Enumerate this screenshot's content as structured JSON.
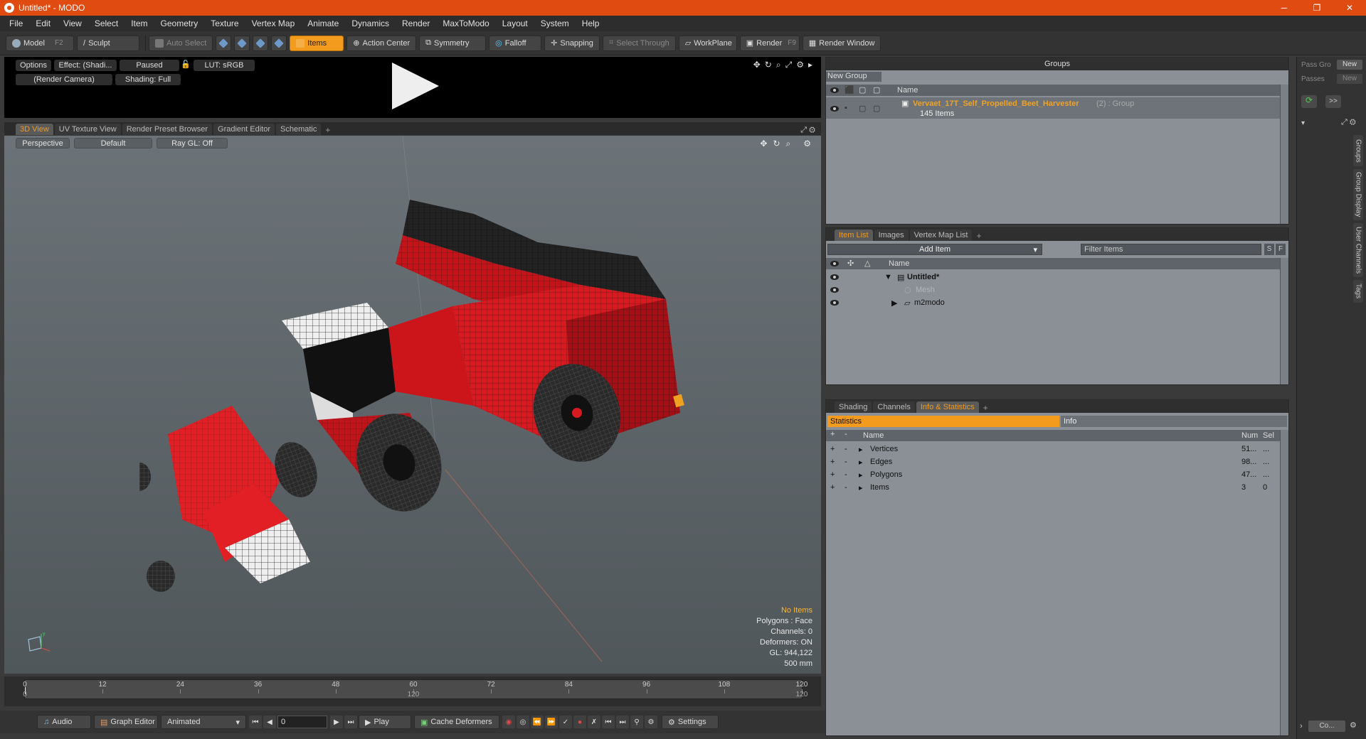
{
  "window": {
    "title": "Untitled* - MODO",
    "minimize": "─",
    "maximize": "❐",
    "close": "✕"
  },
  "menu": [
    "File",
    "Edit",
    "View",
    "Select",
    "Item",
    "Geometry",
    "Texture",
    "Vertex Map",
    "Animate",
    "Dynamics",
    "Render",
    "MaxToModo",
    "Layout",
    "System",
    "Help"
  ],
  "toolbar": {
    "model": "Model",
    "model_key": "F2",
    "sculpt": "Sculpt",
    "auto_select": "Auto Select",
    "items": "Items",
    "action_center": "Action Center",
    "symmetry": "Symmetry",
    "falloff": "Falloff",
    "snapping": "Snapping",
    "select_through": "Select Through",
    "workplane": "WorkPlane",
    "render": "Render",
    "render_key": "F9",
    "render_window": "Render Window"
  },
  "preview": {
    "options": "Options",
    "effect": "Effect: (Shadi...",
    "paused": "Paused",
    "lut": "LUT: sRGB",
    "camera": "(Render Camera)",
    "shading": "Shading: Full"
  },
  "viewport_tabs": [
    "3D View",
    "UV Texture View",
    "Render Preset Browser",
    "Gradient Editor",
    "Schematic"
  ],
  "viewport": {
    "perspective": "Perspective",
    "default": "Default",
    "raygl": "Ray GL: Off",
    "info": {
      "no_items": "No Items",
      "polygons": "Polygons : Face",
      "channels": "Channels: 0",
      "deformers": "Deformers: ON",
      "gl": "GL: 944,122",
      "scale": "500 mm"
    }
  },
  "timeline": {
    "top_ticks": [
      "0",
      "12",
      "24",
      "36",
      "48",
      "60",
      "72",
      "84",
      "96",
      "108",
      "120"
    ],
    "bottom_left": "0",
    "bottom_mid": "120",
    "bottom_right": "120"
  },
  "bottombar": {
    "audio": "Audio",
    "graph_editor": "Graph Editor",
    "animated": "Animated",
    "frame": "0",
    "play": "Play",
    "cache_deformers": "Cache Deformers",
    "settings": "Settings"
  },
  "groups": {
    "title": "Groups",
    "new_group": "New Group",
    "col_name": "Name",
    "item_name": "Vervaet_17T_Self_Propelled_Beet_Harvester",
    "item_count_suffix": "(2) : Group",
    "item_sub": "145 Items"
  },
  "pass": {
    "pass_group": "Pass Gro",
    "new1": "New",
    "passes": "Passes",
    "new2": "New",
    "arrows": ">>"
  },
  "item_list": {
    "tabs": [
      "Item List",
      "Images",
      "Vertex Map List"
    ],
    "add_item": "Add Item",
    "filter": "Filter Items",
    "s": "S",
    "f": "F",
    "col_name": "Name",
    "rows": [
      {
        "name": "Untitled*",
        "bold": true
      },
      {
        "name": "Mesh",
        "dim": true
      },
      {
        "name": "m2modo"
      }
    ]
  },
  "stats": {
    "tabs": [
      "Shading",
      "Channels",
      "Info & Statistics"
    ],
    "statistics": "Statistics",
    "info": "Info",
    "col_name": "Name",
    "col_num": "Num",
    "col_sel": "Sel",
    "rows": [
      {
        "name": "Vertices",
        "num": "51...",
        "sel": "..."
      },
      {
        "name": "Edges",
        "num": "98...",
        "sel": "..."
      },
      {
        "name": "Polygons",
        "num": "47...",
        "sel": "..."
      },
      {
        "name": "Items",
        "num": "3",
        "sel": "0"
      }
    ]
  },
  "side_tabs": [
    "Groups",
    "Group Display",
    "User Channels",
    "Tags"
  ],
  "side_bottom": "Co..."
}
